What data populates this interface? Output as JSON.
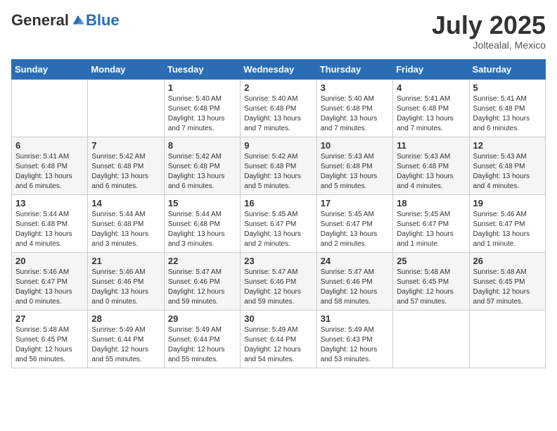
{
  "header": {
    "logo_general": "General",
    "logo_blue": "Blue",
    "month_title": "July 2025",
    "location": "Joltealal, Mexico"
  },
  "weekdays": [
    "Sunday",
    "Monday",
    "Tuesday",
    "Wednesday",
    "Thursday",
    "Friday",
    "Saturday"
  ],
  "weeks": [
    [
      null,
      null,
      {
        "day": "1",
        "sunrise": "Sunrise: 5:40 AM",
        "sunset": "Sunset: 6:48 PM",
        "daylight": "Daylight: 13 hours and 7 minutes."
      },
      {
        "day": "2",
        "sunrise": "Sunrise: 5:40 AM",
        "sunset": "Sunset: 6:48 PM",
        "daylight": "Daylight: 13 hours and 7 minutes."
      },
      {
        "day": "3",
        "sunrise": "Sunrise: 5:40 AM",
        "sunset": "Sunset: 6:48 PM",
        "daylight": "Daylight: 13 hours and 7 minutes."
      },
      {
        "day": "4",
        "sunrise": "Sunrise: 5:41 AM",
        "sunset": "Sunset: 6:48 PM",
        "daylight": "Daylight: 13 hours and 7 minutes."
      },
      {
        "day": "5",
        "sunrise": "Sunrise: 5:41 AM",
        "sunset": "Sunset: 6:48 PM",
        "daylight": "Daylight: 13 hours and 6 minutes."
      }
    ],
    [
      {
        "day": "6",
        "sunrise": "Sunrise: 5:41 AM",
        "sunset": "Sunset: 6:48 PM",
        "daylight": "Daylight: 13 hours and 6 minutes."
      },
      {
        "day": "7",
        "sunrise": "Sunrise: 5:42 AM",
        "sunset": "Sunset: 6:48 PM",
        "daylight": "Daylight: 13 hours and 6 minutes."
      },
      {
        "day": "8",
        "sunrise": "Sunrise: 5:42 AM",
        "sunset": "Sunset: 6:48 PM",
        "daylight": "Daylight: 13 hours and 6 minutes."
      },
      {
        "day": "9",
        "sunrise": "Sunrise: 5:42 AM",
        "sunset": "Sunset: 6:48 PM",
        "daylight": "Daylight: 13 hours and 5 minutes."
      },
      {
        "day": "10",
        "sunrise": "Sunrise: 5:43 AM",
        "sunset": "Sunset: 6:48 PM",
        "daylight": "Daylight: 13 hours and 5 minutes."
      },
      {
        "day": "11",
        "sunrise": "Sunrise: 5:43 AM",
        "sunset": "Sunset: 6:48 PM",
        "daylight": "Daylight: 13 hours and 4 minutes."
      },
      {
        "day": "12",
        "sunrise": "Sunrise: 5:43 AM",
        "sunset": "Sunset: 6:48 PM",
        "daylight": "Daylight: 13 hours and 4 minutes."
      }
    ],
    [
      {
        "day": "13",
        "sunrise": "Sunrise: 5:44 AM",
        "sunset": "Sunset: 6:48 PM",
        "daylight": "Daylight: 13 hours and 4 minutes."
      },
      {
        "day": "14",
        "sunrise": "Sunrise: 5:44 AM",
        "sunset": "Sunset: 6:48 PM",
        "daylight": "Daylight: 13 hours and 3 minutes."
      },
      {
        "day": "15",
        "sunrise": "Sunrise: 5:44 AM",
        "sunset": "Sunset: 6:48 PM",
        "daylight": "Daylight: 13 hours and 3 minutes."
      },
      {
        "day": "16",
        "sunrise": "Sunrise: 5:45 AM",
        "sunset": "Sunset: 6:47 PM",
        "daylight": "Daylight: 13 hours and 2 minutes."
      },
      {
        "day": "17",
        "sunrise": "Sunrise: 5:45 AM",
        "sunset": "Sunset: 6:47 PM",
        "daylight": "Daylight: 13 hours and 2 minutes."
      },
      {
        "day": "18",
        "sunrise": "Sunrise: 5:45 AM",
        "sunset": "Sunset: 6:47 PM",
        "daylight": "Daylight: 13 hours and 1 minute."
      },
      {
        "day": "19",
        "sunrise": "Sunrise: 5:46 AM",
        "sunset": "Sunset: 6:47 PM",
        "daylight": "Daylight: 13 hours and 1 minute."
      }
    ],
    [
      {
        "day": "20",
        "sunrise": "Sunrise: 5:46 AM",
        "sunset": "Sunset: 6:47 PM",
        "daylight": "Daylight: 13 hours and 0 minutes."
      },
      {
        "day": "21",
        "sunrise": "Sunrise: 5:46 AM",
        "sunset": "Sunset: 6:46 PM",
        "daylight": "Daylight: 13 hours and 0 minutes."
      },
      {
        "day": "22",
        "sunrise": "Sunrise: 5:47 AM",
        "sunset": "Sunset: 6:46 PM",
        "daylight": "Daylight: 12 hours and 59 minutes."
      },
      {
        "day": "23",
        "sunrise": "Sunrise: 5:47 AM",
        "sunset": "Sunset: 6:46 PM",
        "daylight": "Daylight: 12 hours and 59 minutes."
      },
      {
        "day": "24",
        "sunrise": "Sunrise: 5:47 AM",
        "sunset": "Sunset: 6:46 PM",
        "daylight": "Daylight: 12 hours and 58 minutes."
      },
      {
        "day": "25",
        "sunrise": "Sunrise: 5:48 AM",
        "sunset": "Sunset: 6:45 PM",
        "daylight": "Daylight: 12 hours and 57 minutes."
      },
      {
        "day": "26",
        "sunrise": "Sunrise: 5:48 AM",
        "sunset": "Sunset: 6:45 PM",
        "daylight": "Daylight: 12 hours and 57 minutes."
      }
    ],
    [
      {
        "day": "27",
        "sunrise": "Sunrise: 5:48 AM",
        "sunset": "Sunset: 6:45 PM",
        "daylight": "Daylight: 12 hours and 56 minutes."
      },
      {
        "day": "28",
        "sunrise": "Sunrise: 5:49 AM",
        "sunset": "Sunset: 6:44 PM",
        "daylight": "Daylight: 12 hours and 55 minutes."
      },
      {
        "day": "29",
        "sunrise": "Sunrise: 5:49 AM",
        "sunset": "Sunset: 6:44 PM",
        "daylight": "Daylight: 12 hours and 55 minutes."
      },
      {
        "day": "30",
        "sunrise": "Sunrise: 5:49 AM",
        "sunset": "Sunset: 6:44 PM",
        "daylight": "Daylight: 12 hours and 54 minutes."
      },
      {
        "day": "31",
        "sunrise": "Sunrise: 5:49 AM",
        "sunset": "Sunset: 6:43 PM",
        "daylight": "Daylight: 12 hours and 53 minutes."
      },
      null,
      null
    ]
  ]
}
